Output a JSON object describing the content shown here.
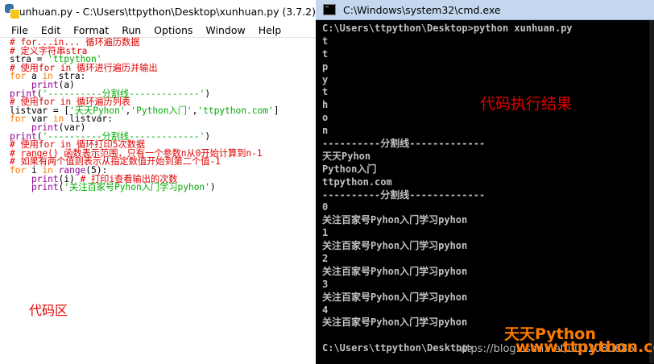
{
  "idle": {
    "title": "xunhuan.py - C:\\Users\\ttpython\\Desktop\\xunhuan.py (3.7.2)",
    "menus": [
      "File",
      "Edit",
      "Format",
      "Run",
      "Options",
      "Window",
      "Help"
    ],
    "code_lines": [
      [
        {
          "c": "com",
          "t": "# for...in... 循环遍历数据"
        }
      ],
      [
        {
          "c": "com",
          "t": "# 定义字符串stra"
        }
      ],
      [
        {
          "c": "txt",
          "t": "stra = "
        },
        {
          "c": "str",
          "t": "'ttpython'"
        }
      ],
      [
        {
          "c": "com",
          "t": "# 使用for in 循环进行遍历并输出"
        }
      ],
      [
        {
          "c": "kw",
          "t": "for"
        },
        {
          "c": "txt",
          "t": " a "
        },
        {
          "c": "kw",
          "t": "in"
        },
        {
          "c": "txt",
          "t": " stra:"
        }
      ],
      [
        {
          "c": "txt",
          "t": "    "
        },
        {
          "c": "bi",
          "t": "print"
        },
        {
          "c": "txt",
          "t": "(a)"
        }
      ],
      [
        {
          "c": "bi",
          "t": "print"
        },
        {
          "c": "txt",
          "t": "("
        },
        {
          "c": "str",
          "t": "'----------分割线-------------'"
        },
        {
          "c": "txt",
          "t": ")"
        }
      ],
      [
        {
          "c": "com",
          "t": "# 使用for in 循环遍历列表"
        }
      ],
      [
        {
          "c": "txt",
          "t": "listvar = ["
        },
        {
          "c": "str",
          "t": "'天天Pyhon'"
        },
        {
          "c": "txt",
          "t": ","
        },
        {
          "c": "str",
          "t": "'Python入门'"
        },
        {
          "c": "txt",
          "t": ","
        },
        {
          "c": "str",
          "t": "'ttpython.com'"
        },
        {
          "c": "txt",
          "t": "]"
        }
      ],
      [
        {
          "c": "kw",
          "t": "for"
        },
        {
          "c": "txt",
          "t": " var "
        },
        {
          "c": "kw",
          "t": "in"
        },
        {
          "c": "txt",
          "t": " listvar:"
        }
      ],
      [
        {
          "c": "txt",
          "t": "    "
        },
        {
          "c": "bi",
          "t": "print"
        },
        {
          "c": "txt",
          "t": "(var)"
        }
      ],
      [
        {
          "c": "bi",
          "t": "print"
        },
        {
          "c": "txt",
          "t": "("
        },
        {
          "c": "str",
          "t": "'----------分割线-------------'"
        },
        {
          "c": "txt",
          "t": ")"
        }
      ],
      [
        {
          "c": "com",
          "t": "# 使用for in 循环打印5次数据"
        }
      ],
      [
        {
          "c": "com",
          "t": "# range() 函数表示范围，只有一个参数n从0开始计算到n-1"
        }
      ],
      [
        {
          "c": "com",
          "t": "# 如果有两个值则表示从指定数值开始到第二个值-1"
        }
      ],
      [
        {
          "c": "kw",
          "t": "for"
        },
        {
          "c": "txt",
          "t": " i "
        },
        {
          "c": "kw",
          "t": "in"
        },
        {
          "c": "txt",
          "t": " "
        },
        {
          "c": "bi",
          "t": "range"
        },
        {
          "c": "txt",
          "t": "(5):"
        }
      ],
      [
        {
          "c": "txt",
          "t": "    "
        },
        {
          "c": "bi",
          "t": "print"
        },
        {
          "c": "txt",
          "t": "(i) "
        },
        {
          "c": "com",
          "t": "# 打印i查看输出的次数"
        }
      ],
      [
        {
          "c": "txt",
          "t": "    "
        },
        {
          "c": "bi",
          "t": "print"
        },
        {
          "c": "txt",
          "t": "("
        },
        {
          "c": "str",
          "t": "'关注百家号Pyhon入门学习pyhon'"
        },
        {
          "c": "txt",
          "t": ")"
        }
      ]
    ],
    "label": "代码区"
  },
  "cmd": {
    "title": "C:\\Windows\\system32\\cmd.exe",
    "lines": [
      "C:\\Users\\ttpython\\Desktop>python xunhuan.py",
      "t",
      "t",
      "p",
      "y",
      "t",
      "h",
      "o",
      "n",
      "----------分割线-------------",
      "天天Pyhon",
      "Python入门",
      "ttpython.com",
      "----------分割线-------------",
      "0",
      "关注百家号Pyhon入门学习pyhon",
      "1",
      "关注百家号Pyhon入门学习pyhon",
      "2",
      "关注百家号Pyhon入门学习pyhon",
      "3",
      "关注百家号Pyhon入门学习pyhon",
      "4",
      "关注百家号Pyhon入门学习pyhon",
      "",
      "C:\\Users\\ttpython\\Desktop>"
    ],
    "label": "代码执行结果"
  },
  "watermark": {
    "brand": "天天Python",
    "url": "https://blog.csdn.net/u012080686",
    "site": "www.ttpython.com"
  },
  "colors": {
    "comment": "#dd0000",
    "keyword": "#ff7700",
    "string": "#00aa00",
    "builtin": "#900090",
    "annotation": "#e00000",
    "watermark": "#ff7a00"
  }
}
